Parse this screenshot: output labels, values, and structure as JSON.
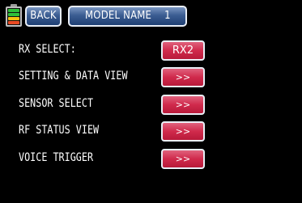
{
  "header": {
    "back_label": "BACK",
    "model_label": "MODEL NAME",
    "model_number": "1"
  },
  "rows": [
    {
      "label": "RX SELECT:",
      "button": "RX2"
    },
    {
      "label": "SETTING & DATA VIEW",
      "button": ">>"
    },
    {
      "label": "SENSOR SELECT",
      "button": ">>"
    },
    {
      "label": "RF STATUS VIEW",
      "button": ">>"
    },
    {
      "label": "VOICE TRIGGER",
      "button": ">>"
    }
  ],
  "colors": {
    "background": "#000000",
    "header_button": "#3b5d92",
    "action_button": "#d02a4c",
    "battery_green": "#2fbf3a",
    "battery_yellow": "#f4c10f",
    "battery_red": "#ea4a22"
  },
  "icons": {
    "battery": "battery-icon"
  }
}
